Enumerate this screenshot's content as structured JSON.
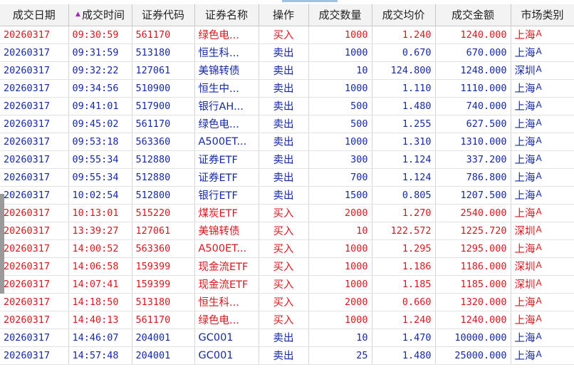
{
  "columns": [
    {
      "label": "成交日期"
    },
    {
      "label": "成交时间",
      "sort_indicator": "▲"
    },
    {
      "label": "证券代码"
    },
    {
      "label": "证券名称"
    },
    {
      "label": "操作"
    },
    {
      "label": "成交数量"
    },
    {
      "label": "成交均价"
    },
    {
      "label": "成交金额"
    },
    {
      "label": "市场类别"
    }
  ],
  "colors": {
    "buy": "#d9151b",
    "sell": "#1428a8",
    "sort_arrow": "#b020c0"
  },
  "rows": [
    {
      "side": "buy",
      "date": "20260317",
      "time": "09:30:59",
      "code": "561170",
      "name": "绿色电...",
      "op": "买入",
      "qty": "1000",
      "price": "1.240",
      "amount": "1240.000",
      "market": "上海",
      "market_suffix": "A"
    },
    {
      "side": "sell",
      "date": "20260317",
      "time": "09:31:59",
      "code": "513180",
      "name": "恒生科...",
      "op": "卖出",
      "qty": "1000",
      "price": "0.670",
      "amount": "670.000",
      "market": "上海",
      "market_suffix": "A"
    },
    {
      "side": "sell",
      "date": "20260317",
      "time": "09:32:22",
      "code": "127061",
      "name": "美锦转债",
      "op": "卖出",
      "qty": "10",
      "price": "124.800",
      "amount": "1248.000",
      "market": "深圳",
      "market_suffix": "A"
    },
    {
      "side": "sell",
      "date": "20260317",
      "time": "09:34:56",
      "code": "510900",
      "name": "恒生中...",
      "op": "卖出",
      "qty": "1000",
      "price": "1.110",
      "amount": "1110.000",
      "market": "上海",
      "market_suffix": "A"
    },
    {
      "side": "sell",
      "date": "20260317",
      "time": "09:41:01",
      "code": "517900",
      "name": "银行AH...",
      "op": "卖出",
      "qty": "500",
      "price": "1.480",
      "amount": "740.000",
      "market": "上海",
      "market_suffix": "A"
    },
    {
      "side": "sell",
      "date": "20260317",
      "time": "09:45:02",
      "code": "561170",
      "name": "绿色电...",
      "op": "卖出",
      "qty": "500",
      "price": "1.255",
      "amount": "627.500",
      "market": "上海",
      "market_suffix": "A"
    },
    {
      "side": "sell",
      "date": "20260317",
      "time": "09:53:18",
      "code": "563360",
      "name": "A500ET...",
      "op": "卖出",
      "qty": "1000",
      "price": "1.310",
      "amount": "1310.000",
      "market": "上海",
      "market_suffix": "A"
    },
    {
      "side": "sell",
      "date": "20260317",
      "time": "09:55:34",
      "code": "512880",
      "name": "证券ETF",
      "op": "卖出",
      "qty": "300",
      "price": "1.124",
      "amount": "337.200",
      "market": "上海",
      "market_suffix": "A"
    },
    {
      "side": "sell",
      "date": "20260317",
      "time": "09:55:34",
      "code": "512880",
      "name": "证券ETF",
      "op": "卖出",
      "qty": "700",
      "price": "1.124",
      "amount": "786.800",
      "market": "上海",
      "market_suffix": "A"
    },
    {
      "side": "sell",
      "date": "20260317",
      "time": "10:02:54",
      "code": "512800",
      "name": "银行ETF",
      "op": "卖出",
      "qty": "1500",
      "price": "0.805",
      "amount": "1207.500",
      "market": "上海",
      "market_suffix": "A"
    },
    {
      "side": "buy",
      "date": "20260317",
      "time": "10:13:01",
      "code": "515220",
      "name": "煤炭ETF",
      "op": "买入",
      "qty": "2000",
      "price": "1.270",
      "amount": "2540.000",
      "market": "上海",
      "market_suffix": "A"
    },
    {
      "side": "buy",
      "date": "20260317",
      "time": "13:39:27",
      "code": "127061",
      "name": "美锦转债",
      "op": "买入",
      "qty": "10",
      "price": "122.572",
      "amount": "1225.720",
      "market": "深圳",
      "market_suffix": "A"
    },
    {
      "side": "buy",
      "date": "20260317",
      "time": "14:00:52",
      "code": "563360",
      "name": "A500ET...",
      "op": "买入",
      "qty": "1000",
      "price": "1.295",
      "amount": "1295.000",
      "market": "上海",
      "market_suffix": "A"
    },
    {
      "side": "buy",
      "date": "20260317",
      "time": "14:06:58",
      "code": "159399",
      "name": "现金流ETF",
      "op": "买入",
      "qty": "1000",
      "price": "1.186",
      "amount": "1186.000",
      "market": "深圳",
      "market_suffix": "A"
    },
    {
      "side": "buy",
      "date": "20260317",
      "time": "14:07:41",
      "code": "159399",
      "name": "现金流ETF",
      "op": "买入",
      "qty": "1000",
      "price": "1.185",
      "amount": "1185.000",
      "market": "深圳",
      "market_suffix": "A"
    },
    {
      "side": "buy",
      "date": "20260317",
      "time": "14:18:50",
      "code": "513180",
      "name": "恒生科...",
      "op": "买入",
      "qty": "2000",
      "price": "0.660",
      "amount": "1320.000",
      "market": "上海",
      "market_suffix": "A"
    },
    {
      "side": "buy",
      "date": "20260317",
      "time": "14:40:13",
      "code": "561170",
      "name": "绿色电...",
      "op": "买入",
      "qty": "1000",
      "price": "1.240",
      "amount": "1240.000",
      "market": "上海",
      "market_suffix": "A"
    },
    {
      "side": "sell",
      "date": "20260317",
      "time": "14:46:07",
      "code": "204001",
      "name": "GC001",
      "op": "卖出",
      "qty": "10",
      "price": "1.470",
      "amount": "10000.000",
      "market": "上海",
      "market_suffix": "A"
    },
    {
      "side": "sell",
      "date": "20260317",
      "time": "14:57:48",
      "code": "204001",
      "name": "GC001",
      "op": "卖出",
      "qty": "25",
      "price": "1.480",
      "amount": "25000.000",
      "market": "上海",
      "market_suffix": "A"
    }
  ]
}
